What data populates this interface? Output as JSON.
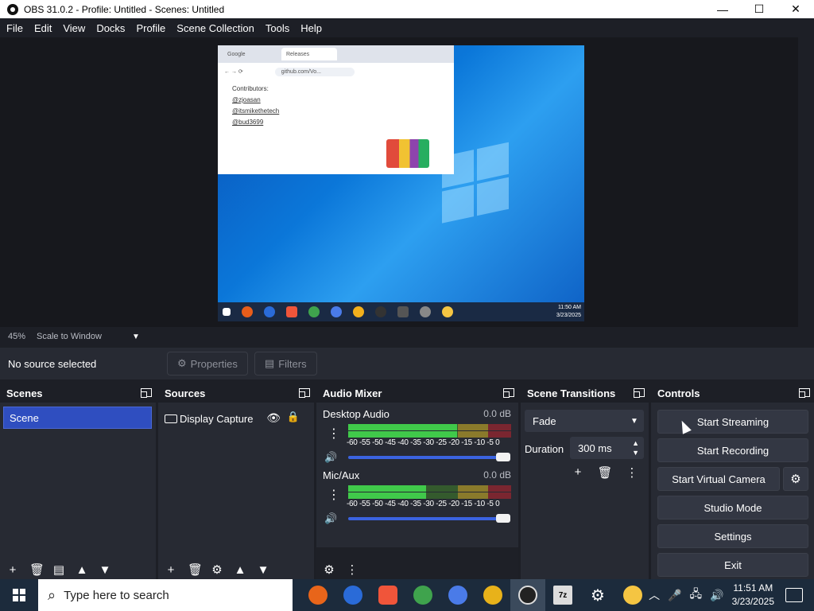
{
  "window": {
    "title": "OBS 31.0.2 - Profile: Untitled - Scenes: Untitled",
    "minimize_icon": "minimize-icon",
    "maximize_icon": "maximize-icon",
    "close_icon": "close-icon"
  },
  "menu": [
    "File",
    "Edit",
    "View",
    "Docks",
    "Profile",
    "Scene Collection",
    "Tools",
    "Help"
  ],
  "preview": {
    "browser_tabs": [
      "Google",
      "Releases"
    ],
    "browser_url": "github.com/Vo...",
    "browser_text": [
      "Contributors:",
      "@zjoasan",
      "@itsmikethetech",
      "@bud3699"
    ],
    "guest_clock_time": "11:50 AM",
    "guest_clock_date": "3/23/2025"
  },
  "zoom": {
    "percent": "45%",
    "mode": "Scale to Window"
  },
  "source_toolbar": {
    "status": "No source selected",
    "properties": "Properties",
    "filters": "Filters"
  },
  "docks": {
    "scenes": {
      "title": "Scenes",
      "items": [
        "Scene"
      ]
    },
    "sources": {
      "title": "Sources",
      "items": [
        "Display Capture"
      ]
    },
    "mixer": {
      "title": "Audio Mixer",
      "channels": [
        {
          "name": "Desktop Audio",
          "db": "0.0 dB",
          "level": 0.67
        },
        {
          "name": "Mic/Aux",
          "db": "0.0 dB",
          "level": 0.48
        }
      ],
      "scale": "-60 -55 -50 -45 -40 -35 -30 -25 -20 -15 -10 -5 0"
    },
    "transitions": {
      "title": "Scene Transitions",
      "selected": "Fade",
      "duration_label": "Duration",
      "duration_value": "300 ms"
    },
    "controls": {
      "title": "Controls",
      "start_streaming": "Start Streaming",
      "start_recording": "Start Recording",
      "start_virtual_camera": "Start Virtual Camera",
      "studio_mode": "Studio Mode",
      "settings": "Settings",
      "exit": "Exit"
    }
  },
  "taskbar": {
    "search_placeholder": "Type here to search",
    "time": "11:51 AM",
    "date": "3/23/2025"
  }
}
